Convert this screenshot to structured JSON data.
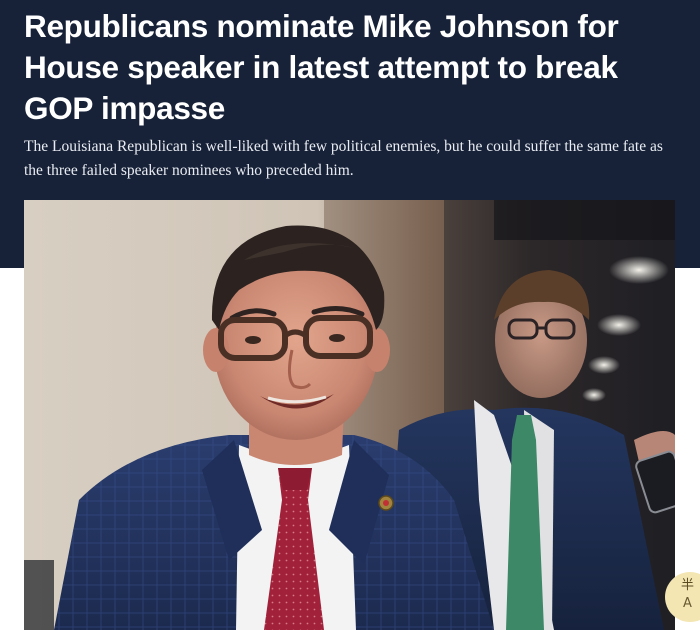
{
  "article": {
    "headline": "Republicans nominate Mike Johnson for House speaker in latest attempt to break GOP impasse",
    "dek": "The Louisiana Republican is well-liked with few political enemies, but he could suffer the same fate as the three failed speaker nominees who preceded him."
  },
  "colors": {
    "hero_background": "#172238",
    "headline_text": "#ffffff",
    "dek_text": "#e9ecf2"
  },
  "floating_widget": {
    "icon": "mascot-icon",
    "glyph_1": "半",
    "glyph_2": "A"
  }
}
